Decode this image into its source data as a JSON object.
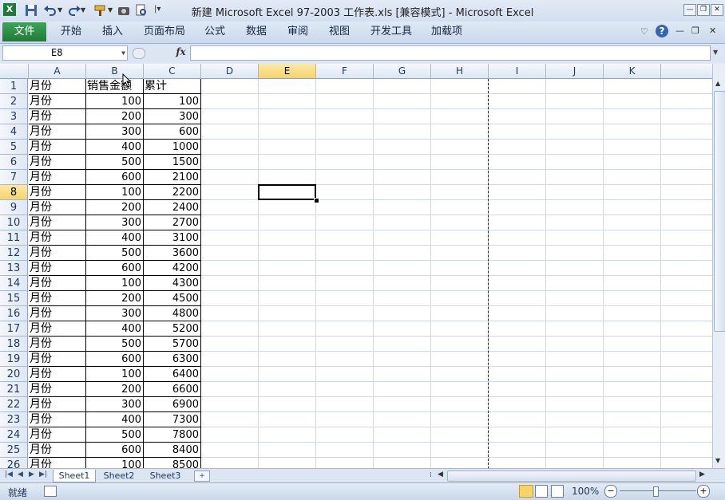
{
  "window": {
    "title": "新建 Microsoft Excel 97-2003 工作表.xls  [兼容模式]  -  Microsoft Excel",
    "minimize": "—",
    "restore": "❐",
    "close": "✕"
  },
  "ribbon": {
    "file_tab": "文件",
    "tabs": [
      "开始",
      "插入",
      "页面布局",
      "公式",
      "数据",
      "审阅",
      "视图",
      "开发工具",
      "加载项"
    ]
  },
  "formula_bar": {
    "name_box": "E8",
    "fx": "fx",
    "value": ""
  },
  "sheet": {
    "columns": [
      "A",
      "B",
      "C",
      "D",
      "E",
      "F",
      "G",
      "H",
      "I",
      "J",
      "K"
    ],
    "selected_column": "E",
    "selected_row": "8",
    "header": {
      "a": "月份",
      "b": "销售金额",
      "c": "累计"
    },
    "rows": [
      {
        "n": "2",
        "a": "月份",
        "b": "100",
        "c": "100"
      },
      {
        "n": "3",
        "a": "月份",
        "b": "200",
        "c": "300"
      },
      {
        "n": "4",
        "a": "月份",
        "b": "300",
        "c": "600"
      },
      {
        "n": "5",
        "a": "月份",
        "b": "400",
        "c": "1000"
      },
      {
        "n": "6",
        "a": "月份",
        "b": "500",
        "c": "1500"
      },
      {
        "n": "7",
        "a": "月份",
        "b": "600",
        "c": "2100"
      },
      {
        "n": "8",
        "a": "月份",
        "b": "100",
        "c": "2200"
      },
      {
        "n": "9",
        "a": "月份",
        "b": "200",
        "c": "2400"
      },
      {
        "n": "10",
        "a": "月份",
        "b": "300",
        "c": "2700"
      },
      {
        "n": "11",
        "a": "月份",
        "b": "400",
        "c": "3100"
      },
      {
        "n": "12",
        "a": "月份",
        "b": "500",
        "c": "3600"
      },
      {
        "n": "13",
        "a": "月份",
        "b": "600",
        "c": "4200"
      },
      {
        "n": "14",
        "a": "月份",
        "b": "100",
        "c": "4300"
      },
      {
        "n": "15",
        "a": "月份",
        "b": "200",
        "c": "4500"
      },
      {
        "n": "16",
        "a": "月份",
        "b": "300",
        "c": "4800"
      },
      {
        "n": "17",
        "a": "月份",
        "b": "400",
        "c": "5200"
      },
      {
        "n": "18",
        "a": "月份",
        "b": "500",
        "c": "5700"
      },
      {
        "n": "19",
        "a": "月份",
        "b": "600",
        "c": "6300"
      },
      {
        "n": "20",
        "a": "月份",
        "b": "100",
        "c": "6400"
      },
      {
        "n": "21",
        "a": "月份",
        "b": "200",
        "c": "6600"
      },
      {
        "n": "22",
        "a": "月份",
        "b": "300",
        "c": "6900"
      },
      {
        "n": "23",
        "a": "月份",
        "b": "400",
        "c": "7300"
      },
      {
        "n": "24",
        "a": "月份",
        "b": "500",
        "c": "7800"
      },
      {
        "n": "25",
        "a": "月份",
        "b": "600",
        "c": "8400"
      },
      {
        "n": "26",
        "a": "月份",
        "b": "100",
        "c": "8500"
      }
    ]
  },
  "sheet_tabs": [
    "Sheet1",
    "Sheet2",
    "Sheet3"
  ],
  "status": {
    "ready": "就绪",
    "zoom": "100%"
  },
  "colors": {
    "file_tab": "#2a8a44",
    "selection_header": "#f8d36a",
    "grid_line": "#d0d7e5"
  }
}
